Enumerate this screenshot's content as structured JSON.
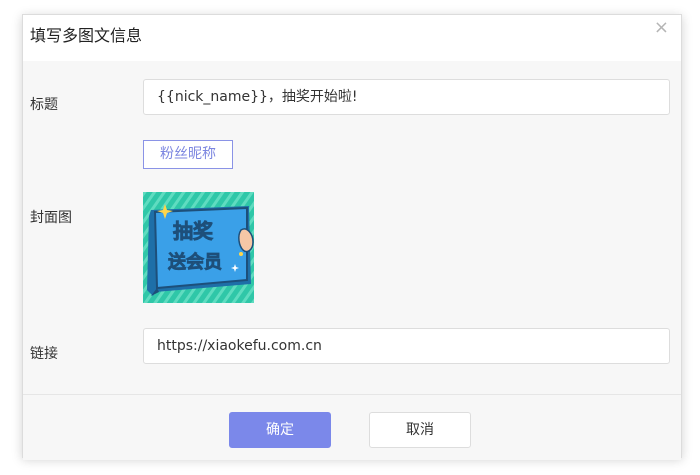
{
  "dialog": {
    "title": "填写多图文信息",
    "close_symbol": "×"
  },
  "form": {
    "title_label": "标题",
    "title_value": "{{nick_name}}，抽奖开始啦!",
    "nickname_button": "粉丝昵称",
    "cover_label": "封面图",
    "cover_image_text": {
      "line1": "抽奖",
      "line2": "送会员"
    },
    "link_label": "链接",
    "link_value": "https://xiaokefu.com.cn"
  },
  "footer": {
    "confirm_label": "确定",
    "cancel_label": "取消"
  },
  "colors": {
    "accent": "#7b88ea",
    "cover_background": "#2ec4a6",
    "cover_card": "#3aa0e8"
  },
  "icons": {
    "close": "close-icon"
  }
}
